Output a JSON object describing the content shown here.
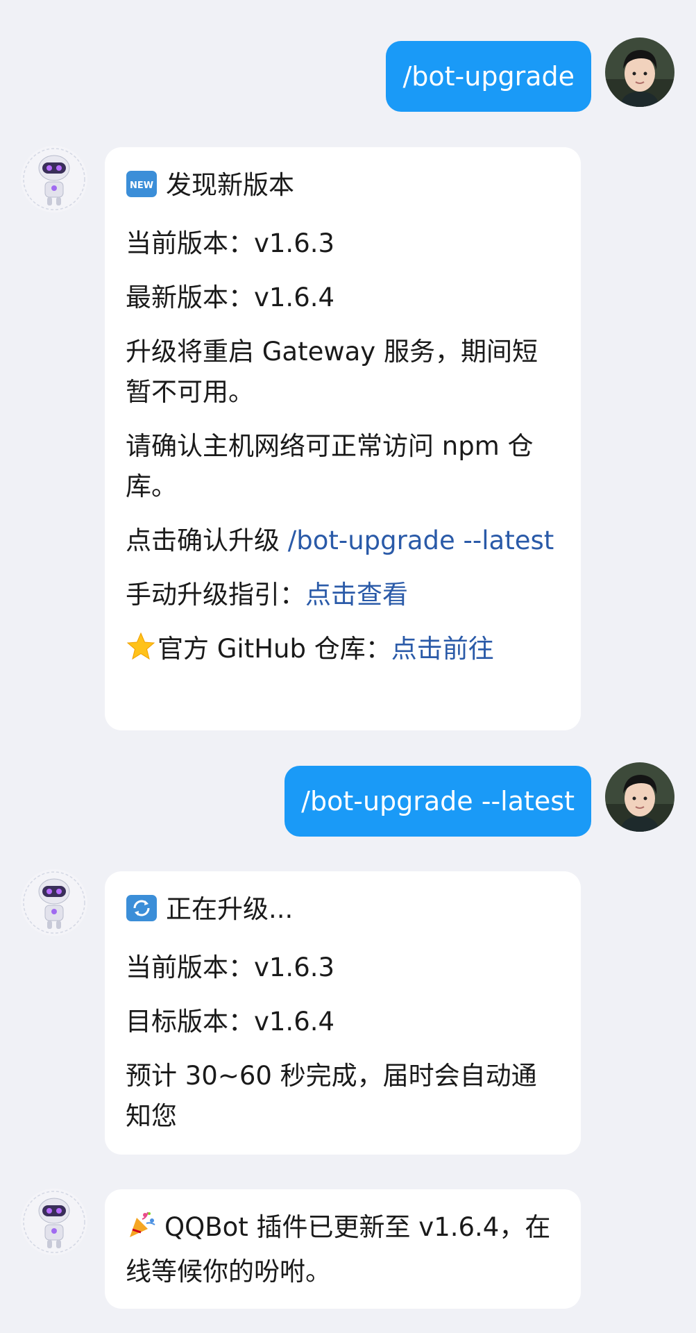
{
  "messages": {
    "user_1": "/bot-upgrade",
    "bot_1": {
      "title": "发现新版本",
      "current": "当前版本：v1.6.3",
      "latest": "最新版本：v1.6.4",
      "restart_notice": "升级将重启 Gateway 服务，期间短暂不可用。",
      "network_notice": "请确认主机网络可正常访问 npm 仓库。",
      "confirm_prefix": "点击确认升级 ",
      "confirm_link": "/bot-upgrade --latest",
      "manual_prefix": "手动升级指引：",
      "manual_link": "点击查看",
      "github_prefix": "官方 GitHub 仓库：",
      "github_link": "点击前往"
    },
    "user_2": "/bot-upgrade --latest",
    "bot_2": {
      "title": "正在升级...",
      "current": "当前版本：v1.6.3",
      "target": "目标版本：v1.6.4",
      "eta": "预计 30~60 秒完成，届时会自动通知您"
    },
    "bot_3": {
      "text": "QQBot 插件已更新至 v1.6.4，在线等候你的吩咐。"
    }
  },
  "icons": {
    "new_badge": "new-badge-icon",
    "refresh": "refresh-icon",
    "party": "party-popper-icon",
    "star": "star-icon",
    "user_avatar": "user-avatar",
    "bot_avatar": "robot-avatar"
  },
  "colors": {
    "background": "#f0f1f6",
    "user_bubble": "#1a9af7",
    "bot_bubble": "#ffffff",
    "link": "#2a5aa8"
  }
}
